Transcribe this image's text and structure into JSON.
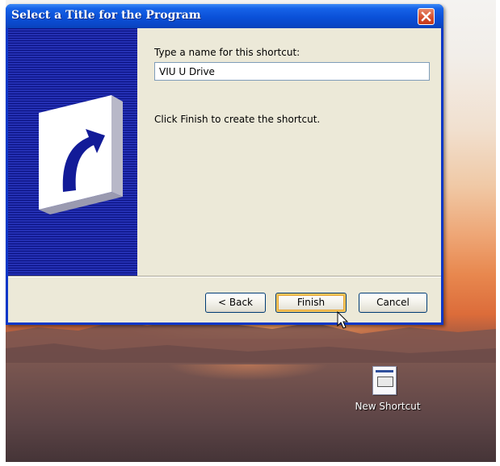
{
  "dialog": {
    "title": "Select a Title for the Program",
    "prompt_label": "Type a name for this shortcut:",
    "name_value": "VIU U Drive",
    "finish_hint": "Click Finish to create the shortcut.",
    "buttons": {
      "back": "< Back",
      "finish": "Finish",
      "cancel": "Cancel"
    }
  },
  "desktop": {
    "shortcut_label": "New Shortcut"
  },
  "colors": {
    "titlebar": "#0a50d8",
    "side_panel": "#121b98",
    "dialog_face": "#ece9d8",
    "close_button": "#d44c2a"
  },
  "icons": [
    "close-icon",
    "shortcut-arrow-icon",
    "shortcut-file-icon",
    "mouse-cursor-icon"
  ]
}
